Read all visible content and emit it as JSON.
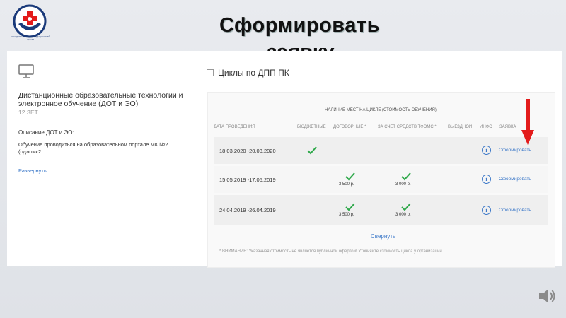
{
  "slide": {
    "title": "Сформировать",
    "title_line2": "заявку",
    "logo_text": "ГОСУДАРСТВЕННЫЙ МЕДИЦИНСКИЙ ЦЕНТР"
  },
  "course": {
    "title": "Дистанционные образовательные технологии и электронное обучение (ДОТ и ЭО)",
    "credits": "12 ЗЕТ",
    "description_heading": "Описание ДОТ и ЭО:",
    "description_text": "Обучение проводиться на образовательном портале МК №2 (одломк2 ...",
    "expand_link": "Развернуть"
  },
  "cycles": {
    "heading": "Циклы по ДПП ПК",
    "group_header": "НАЛИЧИЕ МЕСТ НА ЦИКЛЕ (СТОИМОСТЬ ОБУЧЕНИЯ)",
    "columns": {
      "date": "ДАТА ПРОВЕДЕНИЯ",
      "budget": "БЮДЖЕТНЫЕ",
      "contract": "ДОГОВОРНЫЕ",
      "tfoms": "ЗА СЧЕТ СРЕДСТВ ТФОМС",
      "onsite": "ВЫЕЗДНОЙ",
      "info": "ИНФО",
      "request": "ЗАЯВКА"
    },
    "rows": [
      {
        "date": "18.03.2020 -20.03.2020",
        "budget": true,
        "contract": false,
        "contract_price": "",
        "tfoms": false,
        "tfoms_price": "",
        "action": "Сформировать"
      },
      {
        "date": "15.05.2019 -17.05.2019",
        "budget": false,
        "contract": true,
        "contract_price": "3 500 р.",
        "tfoms": true,
        "tfoms_price": "3 000 р.",
        "action": "Сформировать"
      },
      {
        "date": "24.04.2019 -26.04.2019",
        "budget": false,
        "contract": true,
        "contract_price": "3 500 р.",
        "tfoms": true,
        "tfoms_price": "3 000 р.",
        "action": "Сформировать"
      }
    ],
    "collapse_link": "Свернуть",
    "note": "* ВНИМАНИЕ: Указанная стоимость не является публичной офертой! Уточняйте стоимость цикла у организации"
  },
  "colors": {
    "accent": "#3a77c8",
    "check": "#2ea84a",
    "arrow": "#e31b1b"
  }
}
